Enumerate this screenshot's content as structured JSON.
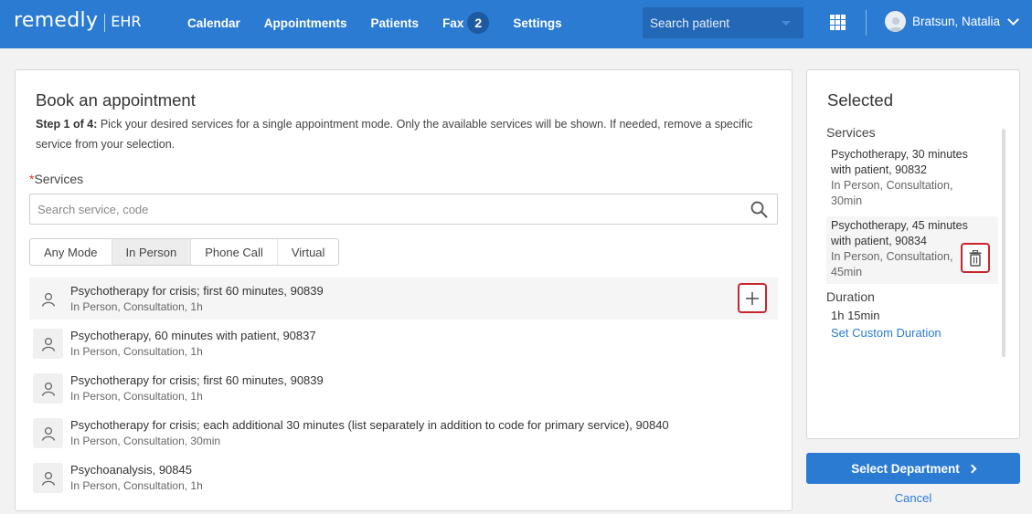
{
  "header": {
    "brand": "remedly",
    "brand_suffix": "EHR",
    "nav": [
      "Calendar",
      "Appointments",
      "Patients",
      "Fax",
      "Settings"
    ],
    "fax_count": "2",
    "search_placeholder": "Search patient",
    "user_name": "Bratsun, Natalia"
  },
  "booking": {
    "title": "Book an appointment",
    "step_label": "Step 1 of 4:",
    "step_text": " Pick your desired services for a single appointment mode. Only the available services will be shown. If needed, remove a specific service from your selection.",
    "services_required_mark": "*",
    "services_label": "Services",
    "search_placeholder": "Search service, code",
    "modes": [
      "Any Mode",
      "In Person",
      "Phone Call",
      "Virtual"
    ],
    "active_mode": "In Person",
    "services": [
      {
        "name": "Psychotherapy for crisis; first 60 minutes, 90839",
        "meta": "In Person, Consultation, 1h"
      },
      {
        "name": "Psychotherapy, 60 minutes with patient, 90837",
        "meta": "In Person, Consultation, 1h"
      },
      {
        "name": "Psychotherapy for crisis; first 60 minutes, 90839",
        "meta": "In Person, Consultation, 1h"
      },
      {
        "name": "Psychotherapy for crisis; each additional 30 minutes (list separately in addition to code for primary service), 90840",
        "meta": "In Person, Consultation, 30min"
      },
      {
        "name": "Psychoanalysis, 90845",
        "meta": "In Person, Consultation, 1h"
      }
    ]
  },
  "selected": {
    "title": "Selected",
    "services_label": "Services",
    "items": [
      {
        "name": "Psychotherapy, 30 minutes with patient, 90832",
        "meta": "In Person, Consultation, 30min"
      },
      {
        "name": "Psychotherapy, 45 minutes with patient, 90834",
        "meta": "In Person, Consultation, 45min"
      }
    ],
    "duration_label": "Duration",
    "duration_value": "1h 15min",
    "custom_duration": "Set Custom Duration"
  },
  "actions": {
    "select_department": "Select Department",
    "cancel": "Cancel"
  },
  "colors": {
    "brand_blue": "#2b7bd3",
    "highlight_red": "#c8262c"
  }
}
